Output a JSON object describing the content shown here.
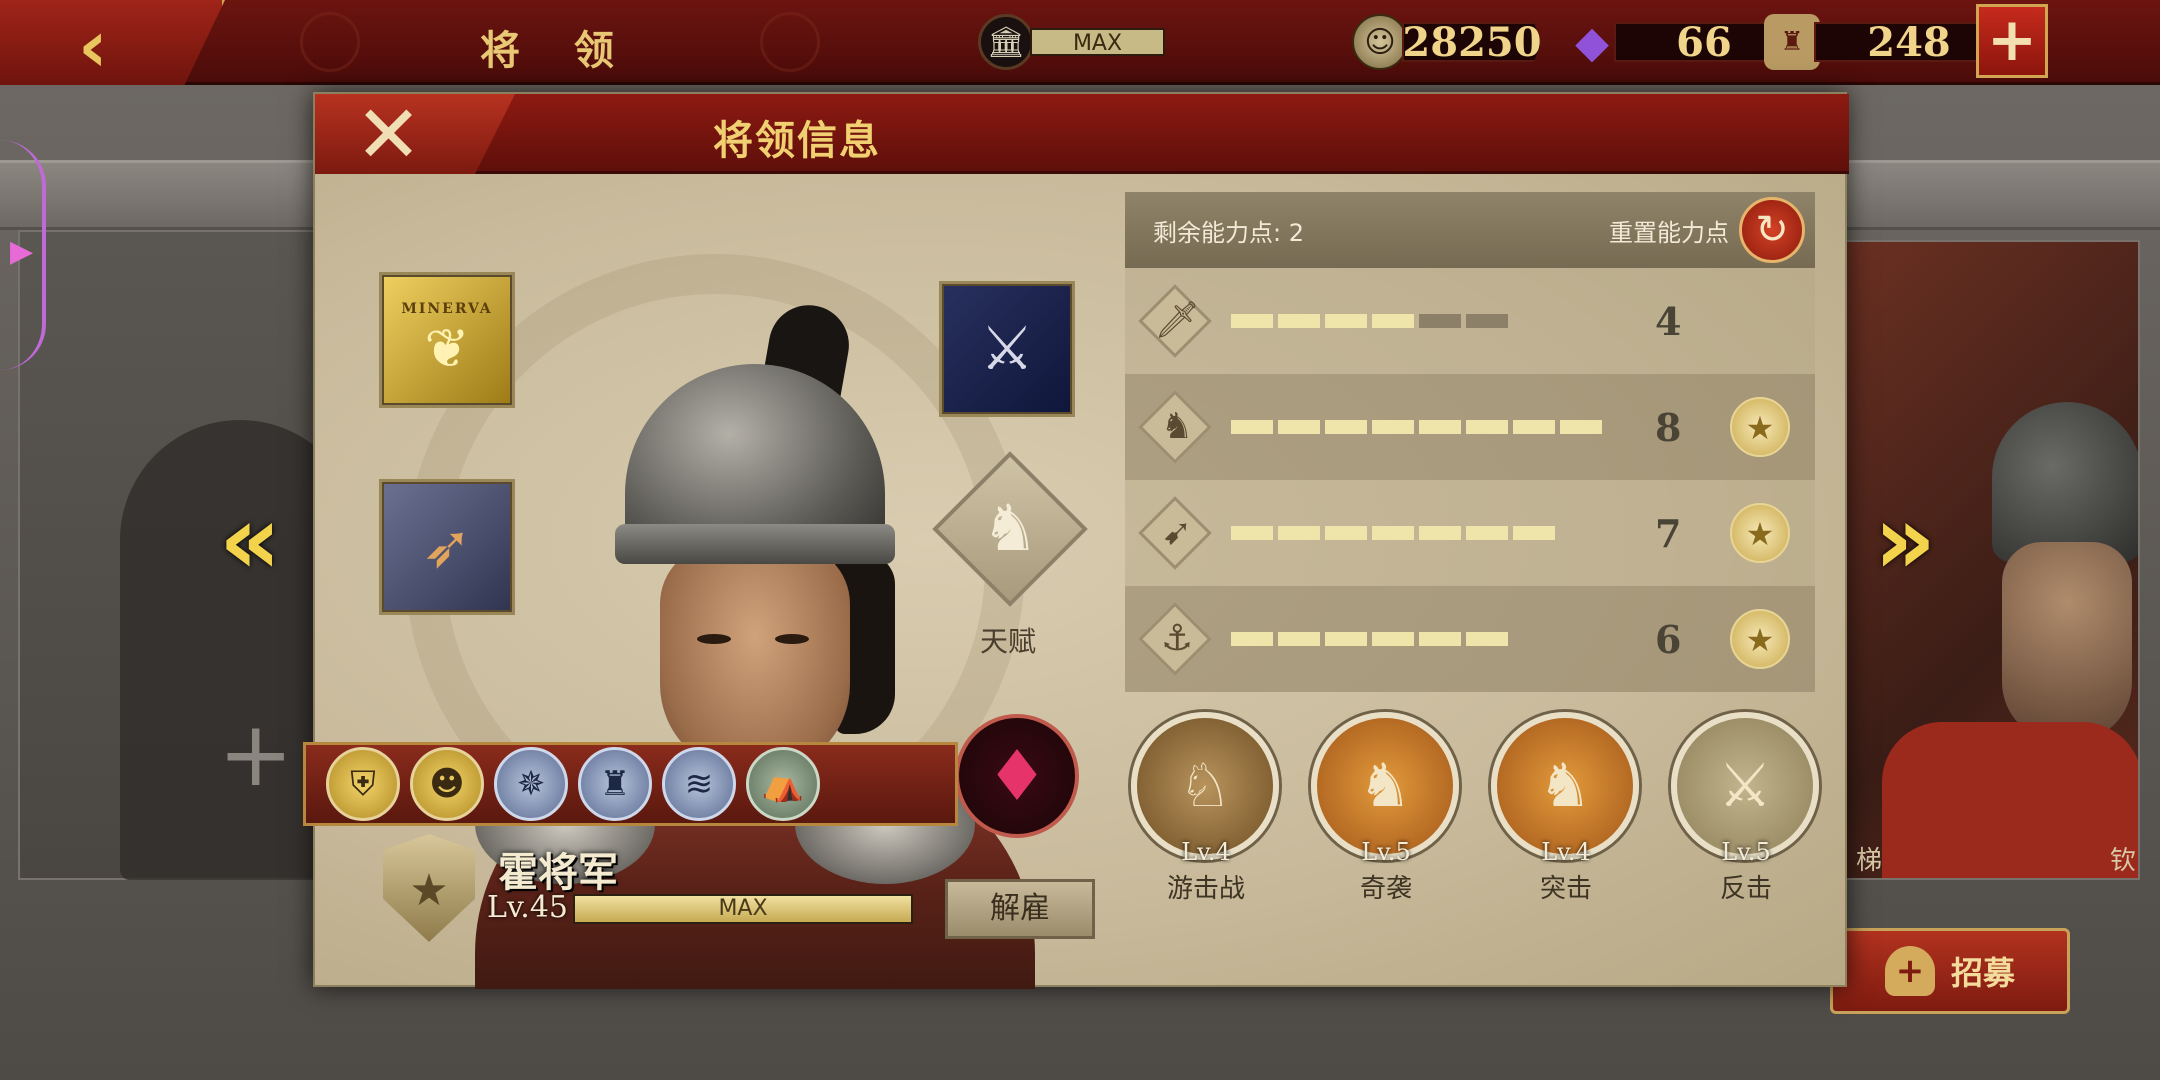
{
  "topbar": {
    "title": "将 领",
    "bank_label": "MAX",
    "coins": "28250",
    "gems": "66",
    "tickets": "248",
    "plus_icon": "plus-icon"
  },
  "modal": {
    "title": "将领信息",
    "close_icon": "close-icon"
  },
  "stats": {
    "remaining_points": "剩余能力点: 2",
    "reset_label": "重置能力点",
    "rows": [
      {
        "icon": "sword-icon",
        "value": "4",
        "filled": 4,
        "total": 6,
        "badge": false
      },
      {
        "icon": "horse-icon",
        "value": "8",
        "filled": 8,
        "total": 8,
        "badge": true
      },
      {
        "icon": "bow-icon",
        "value": "7",
        "filled": 7,
        "total": 7,
        "badge": true
      },
      {
        "icon": "anchor-icon",
        "value": "6",
        "filled": 6,
        "total": 6,
        "badge": true
      }
    ]
  },
  "abilities": [
    {
      "level": "Lv.4",
      "name": "游击战"
    },
    {
      "level": "Lv.5",
      "name": "奇袭"
    },
    {
      "level": "Lv.4",
      "name": "突击"
    },
    {
      "level": "Lv.5",
      "name": "反击"
    }
  ],
  "hero": {
    "name": "霍将军",
    "level": "Lv.45",
    "xp_label": "MAX",
    "xp_fraction": 1.0,
    "dismiss": "解雇"
  },
  "talent": {
    "label": "天赋"
  },
  "equipment": {
    "banner_text": "MINERVA"
  },
  "recruit": {
    "label": "招募"
  },
  "background": {
    "right_names": [
      "梯",
      "钦"
    ]
  },
  "colors": {
    "accent_red": "#8d1a12",
    "gold": "#f0d070",
    "parchment": "#cfc2a4"
  }
}
